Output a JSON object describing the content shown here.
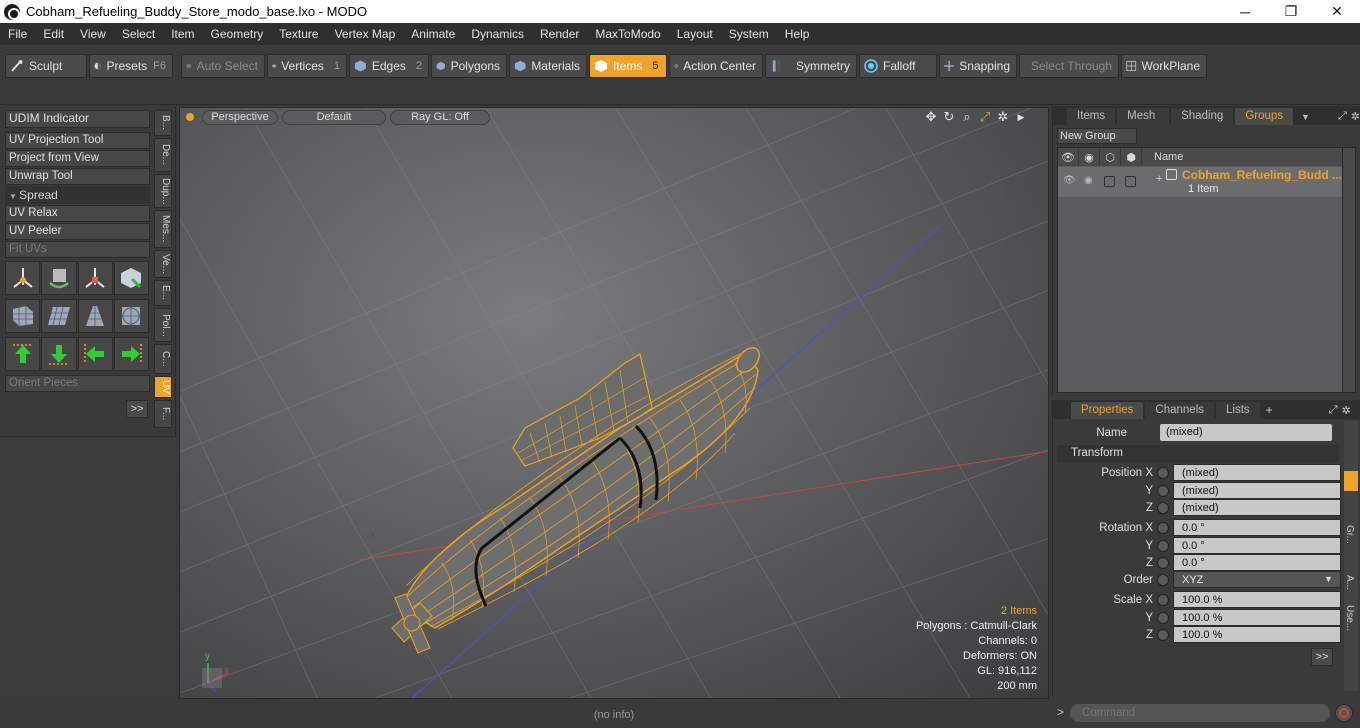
{
  "window": {
    "title": "Cobham_Refueling_Buddy_Store_modo_base.lxo - MODO",
    "minimize": "─",
    "maximize": "❐",
    "close": "✕"
  },
  "menu": [
    "File",
    "Edit",
    "View",
    "Select",
    "Item",
    "Geometry",
    "Texture",
    "Vertex Map",
    "Animate",
    "Dynamics",
    "Render",
    "MaxToModo",
    "Layout",
    "System",
    "Help"
  ],
  "toolbar": {
    "sculpt": "Sculpt",
    "presets": "Presets",
    "presets_key": "F6",
    "auto_select": "Auto Select",
    "vertices": "Vertices",
    "vertices_num": "1",
    "edges": "Edges",
    "edges_num": "2",
    "polygons": "Polygons",
    "materials": "Materials",
    "items": "Items",
    "items_num": "5",
    "action_center": "Action Center",
    "symmetry": "Symmetry",
    "falloff": "Falloff",
    "snapping": "Snapping",
    "select_through": "Select Through",
    "workplane": "WorkPlane"
  },
  "left_panel": {
    "udim_indicator": "UDIM Indicator",
    "uv_projection_tool": "UV Projection Tool",
    "project_from_view": "Project from View",
    "unwrap_tool": "Unwrap Tool",
    "spread": "Spread",
    "uv_relax": "UV Relax",
    "uv_peeler": "UV Peeler",
    "fit_uvs": "Fit UVs",
    "orient_pieces": "Orient Pieces",
    "more": ">>",
    "vtabs": [
      "B...",
      "De...",
      "Dup...",
      "Mes...",
      "Ve...",
      "E...",
      "Pol...",
      "C...",
      "UV",
      "F..."
    ]
  },
  "viewport": {
    "perspective": "Perspective",
    "default": "Default",
    "raygl": "Ray GL: Off",
    "stats": {
      "items": "2 Items",
      "polygons": "Polygons : Catmull-Clark",
      "channels": "Channels: 0",
      "deformers": "Deformers: ON",
      "gl": "GL: 916,112",
      "scale": "200 mm"
    }
  },
  "status": {
    "info": "(no info)"
  },
  "groups_panel": {
    "tabs": [
      "Items",
      "Mesh ...",
      "Shading",
      "Groups"
    ],
    "new_group": "New Group",
    "name_col": "Name",
    "row_name": "Cobham_Refueling_Budd ...",
    "row_sub": "1 Item"
  },
  "properties_panel": {
    "tabs": [
      "Properties",
      "Channels",
      "Lists"
    ],
    "add_tab": "+",
    "name_label": "Name",
    "name_value": "(mixed)",
    "transform": "Transform",
    "position_x": "Position X",
    "y": "Y",
    "z": "Z",
    "mixed": "(mixed)",
    "rotation_x": "Rotation X",
    "rot_val": "0.0 °",
    "order": "Order",
    "order_val": "XYZ",
    "scale_x": "Scale X",
    "scale_val": "100.0 %",
    "more": ">>",
    "side_tabs": [
      "Gr...",
      "A...",
      "Use..."
    ]
  },
  "command": {
    "placeholder": "Command",
    "prompt": ">"
  },
  "colors": {
    "accent": "#f0a328",
    "wire": "#f5a01a"
  }
}
